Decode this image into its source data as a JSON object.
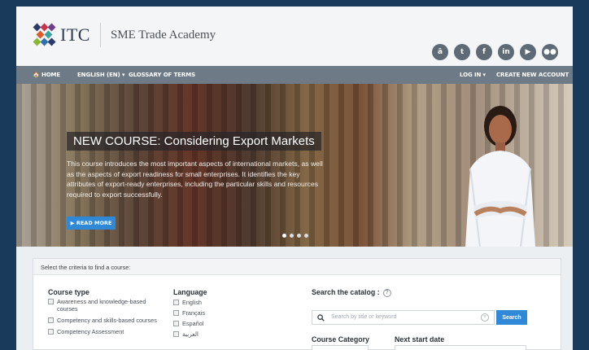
{
  "header": {
    "logo_text": "ITC",
    "academy": "SME Trade Academy",
    "socials": [
      {
        "icon": "account-icon",
        "glyph": "ā"
      },
      {
        "icon": "twitter-icon",
        "glyph": "t"
      },
      {
        "icon": "facebook-icon",
        "glyph": "f"
      },
      {
        "icon": "linkedin-icon",
        "glyph": "in"
      },
      {
        "icon": "youtube-icon",
        "glyph": "▶"
      },
      {
        "icon": "flickr-icon",
        "glyph": "●●"
      }
    ]
  },
  "nav": {
    "home": "🏠 HOME",
    "language": "ENGLISH (EN) ▾",
    "glossary": "GLOSSARY OF TERMS",
    "login": "LOG IN ▾",
    "create_account": "CREATE NEW ACCOUNT"
  },
  "hero": {
    "title": "NEW COURSE: Considering Export Markets",
    "text": "This course introduces the most important aspects of international markets, as well as the aspects of export readiness for small enterprises. It identifies the key attributes of export-ready enterprises, including the particular skills and resources required to export successfully.",
    "read_more": "▶ READ MORE"
  },
  "search_panel": {
    "heading": "Select the criteria to find a course:",
    "course_type": {
      "title": "Course type",
      "options": [
        "Awareness and knowledge-based courses",
        "Competency and skills-based courses",
        "Competency Assessment"
      ]
    },
    "language": {
      "title": "Language",
      "options": [
        "English",
        "Français",
        "Español",
        "العربية"
      ]
    },
    "catalog": {
      "title": "Search the catalog :",
      "placeholder": "Search by title or keyword",
      "button": "Search"
    },
    "course_category": "Course Category",
    "next_start_date": "Next start date"
  },
  "colors": {
    "accent": "#2f89d6",
    "nav": "#6e7b86",
    "page_bg": "#1a3a5c"
  }
}
